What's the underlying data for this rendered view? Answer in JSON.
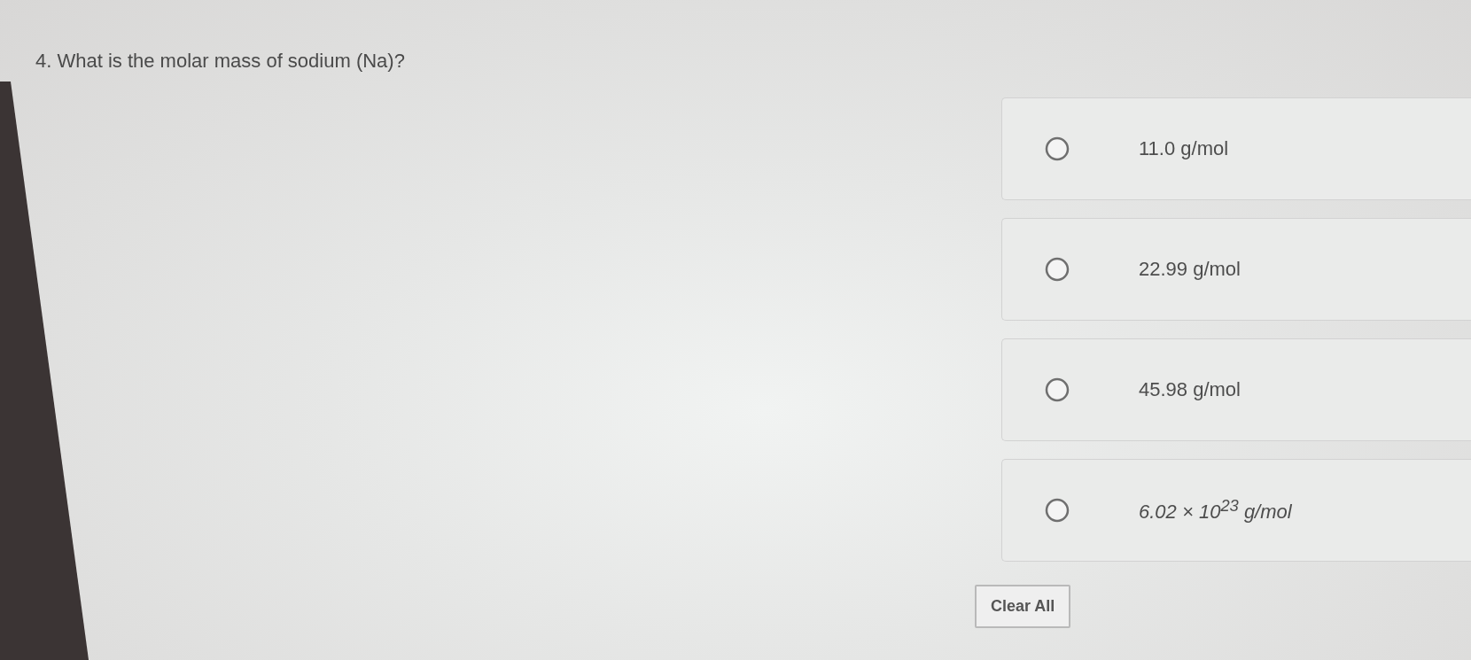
{
  "question": {
    "text": "4. What is the molar mass of sodium (Na)?"
  },
  "options": [
    {
      "kind": "text",
      "label": "11.0 g/mol",
      "selected": false
    },
    {
      "kind": "text",
      "label": "22.99 g/mol",
      "selected": false
    },
    {
      "kind": "text",
      "label": "45.98 g/mol",
      "selected": false
    },
    {
      "kind": "math",
      "label": "6.02 × 10$^{23}$ g/mol",
      "selected": false
    }
  ],
  "clear_button": {
    "label": "Clear All"
  }
}
